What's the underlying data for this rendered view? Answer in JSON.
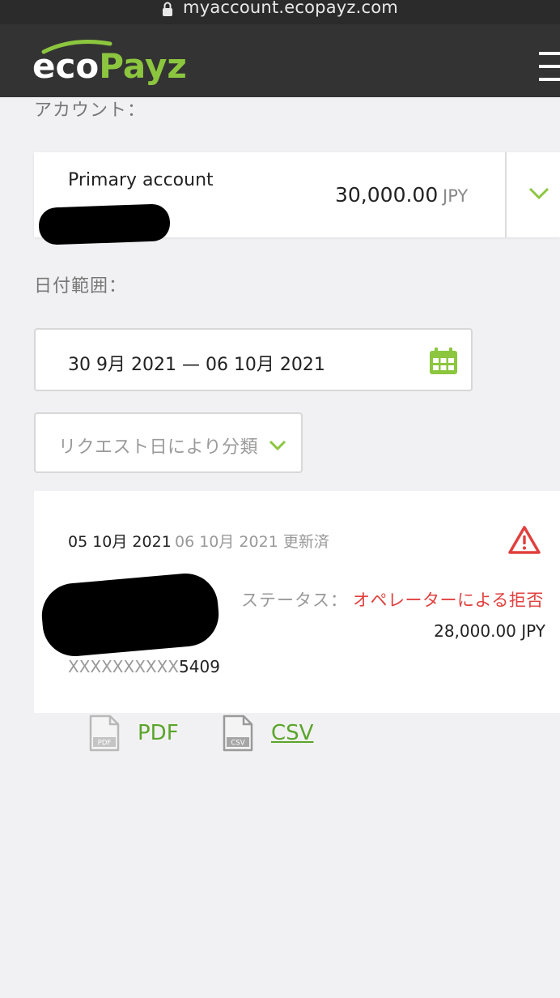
{
  "browser": {
    "url": "myaccount.ecopayz.com"
  },
  "header": {
    "logo_eco": "eco",
    "logo_payz": "Payz"
  },
  "account_section": {
    "label": "アカウント：",
    "account_name": "Primary account",
    "balance": "30,000.00",
    "currency": "JPY"
  },
  "date_range": {
    "label": "日付範囲：",
    "value": "30 9月 2021 — 06 10月 2021"
  },
  "sort": {
    "selected": "リクエスト日により分類"
  },
  "transaction": {
    "date": "05 10月 2021",
    "updated": "06 10月 2021 更新済",
    "status_label": "ステータス：",
    "status_value": "オペレーターによる拒否",
    "amount": "28,000.00 JPY",
    "account_mask": "XXXXXXXXXX",
    "account_last4": "5409"
  },
  "export": {
    "pdf_label": "PDF",
    "csv_label": "CSV"
  },
  "colors": {
    "accent_green": "#8cc63f",
    "link_green": "#5aa52b",
    "error_red": "#e0403e",
    "header_bg": "#333333"
  },
  "icons": [
    "lock-icon",
    "menu-icon",
    "chevron-down-icon",
    "calendar-icon",
    "warning-icon",
    "pdf-file-icon",
    "csv-file-icon"
  ]
}
